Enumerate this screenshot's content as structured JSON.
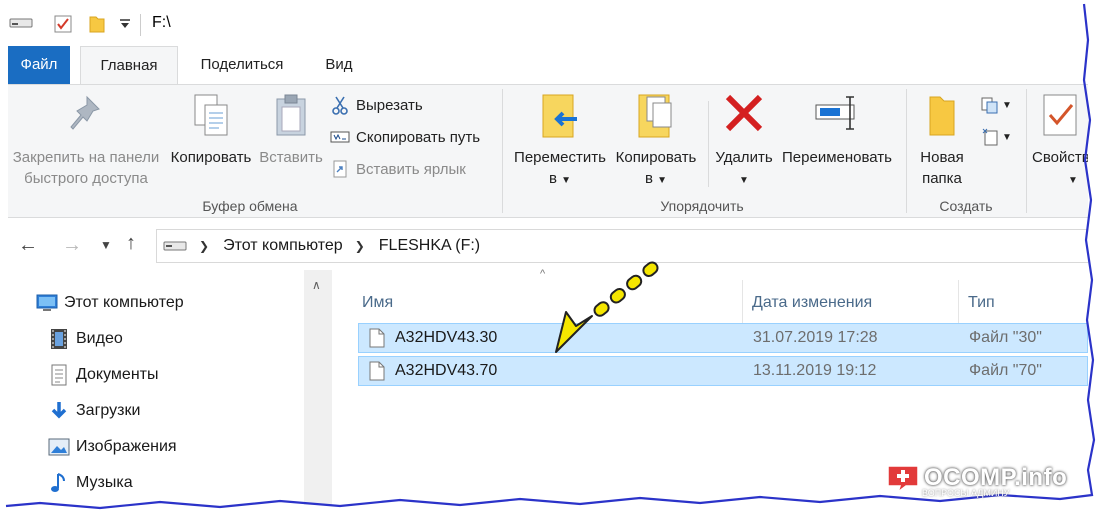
{
  "window": {
    "title": "F:\\"
  },
  "ribbon": {
    "tabs": [
      {
        "label": "Файл"
      },
      {
        "label": "Главная"
      },
      {
        "label": "Поделиться"
      },
      {
        "label": "Вид"
      }
    ],
    "clipboard": {
      "pin_line1": "Закрепить на панели",
      "pin_line2": "быстрого доступа",
      "copy": "Копировать",
      "paste": "Вставить",
      "cut": "Вырезать",
      "copy_path": "Скопировать путь",
      "paste_shortcut": "Вставить ярлык",
      "group": "Буфер обмена"
    },
    "organize": {
      "move_line1": "Переместить",
      "move_line2": "в",
      "copy_line1": "Копировать",
      "copy_line2": "в",
      "delete": "Удалить",
      "rename": "Переименовать",
      "group": "Упорядочить"
    },
    "create": {
      "new_folder_line1": "Новая",
      "new_folder_line2": "папка",
      "group": "Создать"
    },
    "open": {
      "properties": "Свойства"
    }
  },
  "address": {
    "crumbs": [
      "Этот компьютер",
      "FLESHKA (F:)"
    ]
  },
  "nav_pane": {
    "items": [
      {
        "label": "Этот компьютер",
        "icon": "computer-icon"
      },
      {
        "label": "Видео",
        "icon": "video-icon"
      },
      {
        "label": "Документы",
        "icon": "documents-icon"
      },
      {
        "label": "Загрузки",
        "icon": "downloads-icon"
      },
      {
        "label": "Изображения",
        "icon": "pictures-icon"
      },
      {
        "label": "Музыка",
        "icon": "music-icon"
      }
    ]
  },
  "file_list": {
    "columns": [
      "Имя",
      "Дата изменения",
      "Тип"
    ],
    "rows": [
      {
        "name": "A32HDV43.30",
        "date": "31.07.2019 17:28",
        "type": "Файл \"30\"",
        "selected": true
      },
      {
        "name": "A32HDV43.70",
        "date": "13.11.2019 19:12",
        "type": "Файл \"70\"",
        "selected": true
      }
    ]
  },
  "watermark": {
    "brand": "OCOMP.info",
    "tagline": "ВОПРОСЫ АДМИНУ"
  },
  "colors": {
    "accent": "#1a6dc2",
    "selection": "#cce8ff",
    "selection_border": "#99d1ff",
    "annotation_arrow": "#f5e600",
    "frame": "#2b33c9",
    "delete_red": "#d42020"
  }
}
